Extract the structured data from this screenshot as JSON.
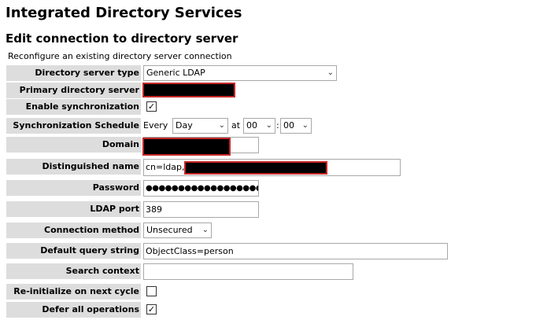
{
  "page": {
    "title": "Integrated Directory Services",
    "subtitle": "Edit connection to directory server",
    "description": "Reconfigure an existing directory server connection"
  },
  "form": {
    "directory_server_type": {
      "label": "Directory server type",
      "value": "Generic LDAP"
    },
    "primary_directory_server": {
      "label": "Primary directory server",
      "value": ""
    },
    "enable_synchronization": {
      "label": "Enable synchronization",
      "checked": true
    },
    "synchronization_schedule": {
      "label": "Synchronization Schedule",
      "every_text": "Every",
      "frequency": "Day",
      "at_text": "at",
      "hour": "00",
      "colon": ":",
      "minute": "00"
    },
    "domain": {
      "label": "Domain",
      "value": ""
    },
    "distinguished_name": {
      "label": "Distinguished name",
      "value_prefix": "cn=ldap,"
    },
    "password": {
      "label": "Password",
      "value": "●●●●●●●●●●●●●●●●●●"
    },
    "ldap_port": {
      "label": "LDAP port",
      "value": "389"
    },
    "connection_method": {
      "label": "Connection method",
      "value": "Unsecured"
    },
    "default_query_string": {
      "label": "Default query string",
      "value": "ObjectClass=person"
    },
    "search_context": {
      "label": "Search context",
      "value": ""
    },
    "reinitialize_next_cycle": {
      "label": "Re-initialize on next cycle",
      "checked": false
    },
    "defer_all_operations": {
      "label": "Defer all operations",
      "checked": true
    }
  },
  "icons": {
    "checkmark": "✓",
    "dropdown_chevron": "⌄"
  },
  "colors": {
    "label_background": "#dddddd",
    "redaction": "#000000",
    "redaction_border": "#c62828"
  }
}
